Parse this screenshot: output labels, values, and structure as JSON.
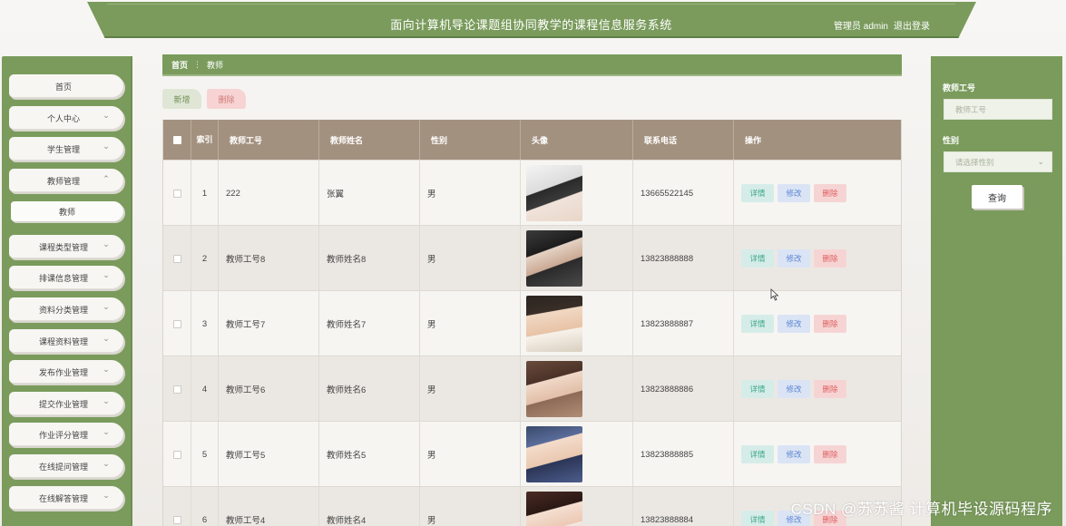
{
  "header": {
    "title": "面向计算机导论课题组协同教学的课程信息服务系统",
    "user": "管理员 admin",
    "logout": "退出登录"
  },
  "sidebar": {
    "items": [
      {
        "label": "首页"
      },
      {
        "label": "个人中心"
      },
      {
        "label": "学生管理"
      },
      {
        "label": "教师管理"
      },
      {
        "label": "教师",
        "sub": true
      },
      {
        "label": "课程类型管理"
      },
      {
        "label": "排课信息管理"
      },
      {
        "label": "资料分类管理"
      },
      {
        "label": "课程资料管理"
      },
      {
        "label": "发布作业管理"
      },
      {
        "label": "提交作业管理"
      },
      {
        "label": "作业评分管理"
      },
      {
        "label": "在线提问管理"
      },
      {
        "label": "在线解答管理"
      }
    ]
  },
  "breadcrumb": {
    "home": "首页",
    "separator": "⋮",
    "current": "教师"
  },
  "toolbar": {
    "add": "新增",
    "delete": "删除"
  },
  "table": {
    "columns": {
      "index": "索引",
      "teacher_no": "教师工号",
      "teacher_name": "教师姓名",
      "gender": "性别",
      "avatar": "头像",
      "phone": "联系电话",
      "actions": "操作"
    },
    "action_labels": {
      "detail": "详情",
      "edit": "修改",
      "delete": "删除"
    },
    "rows": [
      {
        "index": "1",
        "teacher_no": "222",
        "teacher_name": "张翼",
        "gender": "男",
        "phone": "13665522145"
      },
      {
        "index": "2",
        "teacher_no": "教师工号8",
        "teacher_name": "教师姓名8",
        "gender": "男",
        "phone": "13823888888"
      },
      {
        "index": "3",
        "teacher_no": "教师工号7",
        "teacher_name": "教师姓名7",
        "gender": "男",
        "phone": "13823888887"
      },
      {
        "index": "4",
        "teacher_no": "教师工号6",
        "teacher_name": "教师姓名6",
        "gender": "男",
        "phone": "13823888886"
      },
      {
        "index": "5",
        "teacher_no": "教师工号5",
        "teacher_name": "教师姓名5",
        "gender": "男",
        "phone": "13823888885"
      },
      {
        "index": "6",
        "teacher_no": "教师工号4",
        "teacher_name": "教师姓名4",
        "gender": "男",
        "phone": "13823888884"
      }
    ]
  },
  "search": {
    "teacher_no_label": "教师工号",
    "teacher_no_placeholder": "教师工号",
    "gender_label": "性别",
    "gender_placeholder": "请选择性别",
    "query_button": "查询"
  },
  "watermark": "CSDN @苏苏酱    计算机毕设源码程序",
  "colors": {
    "primary": "#7a9b5c",
    "table_header": "#a3917f"
  }
}
